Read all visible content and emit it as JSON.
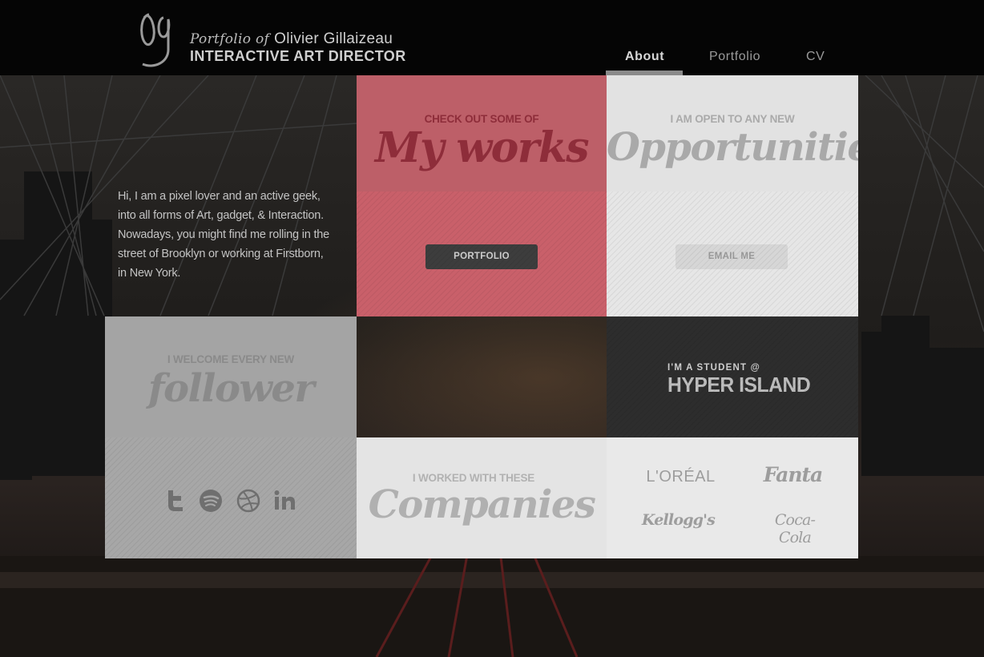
{
  "header": {
    "logo_mark": "og",
    "title_prefix": "Portfolio of",
    "name": "Olivier Gillaizeau",
    "subtitle": "INTERACTIVE ART DIRECTOR"
  },
  "nav": {
    "items": [
      {
        "label": "About",
        "active": true
      },
      {
        "label": "Portfolio",
        "active": false
      },
      {
        "label": "CV",
        "active": false
      }
    ]
  },
  "intro": {
    "lines": [
      "Hi, I am a pixel lover and an active geek,",
      "into all forms of Art, gadget, & Interaction.",
      "Nowadays, you might find me rolling in the",
      "street of Brooklyn or working at Firstborn,",
      "in New York."
    ]
  },
  "works": {
    "kicker": "CHECK OUT SOME OF",
    "headline": "My works",
    "button": "PORTFOLIO"
  },
  "opportunities": {
    "kicker": "I AM OPEN TO ANY NEW",
    "headline": "Opportunities",
    "button": "EMAIL ME"
  },
  "follower": {
    "kicker": "I WELCOME EVERY NEW",
    "headline": "follower",
    "icons": [
      "twitter-icon",
      "spotify-icon",
      "dribbble-icon",
      "linkedin-icon"
    ]
  },
  "student": {
    "line1": "I'M A STUDENT @",
    "line2": "HYPER ISLAND"
  },
  "companies": {
    "kicker": "I WORKED WITH THESE",
    "headline": "Companies",
    "brands": [
      "L'ORÉAL",
      "Fanta",
      "Kellogg's",
      "Coca-Cola"
    ]
  },
  "colors": {
    "accent_pink": "#c45a66",
    "dark_tile": "#2b2b2b",
    "light_tile": "#e3e3e3",
    "grey_tile": "#a3a3a3"
  }
}
